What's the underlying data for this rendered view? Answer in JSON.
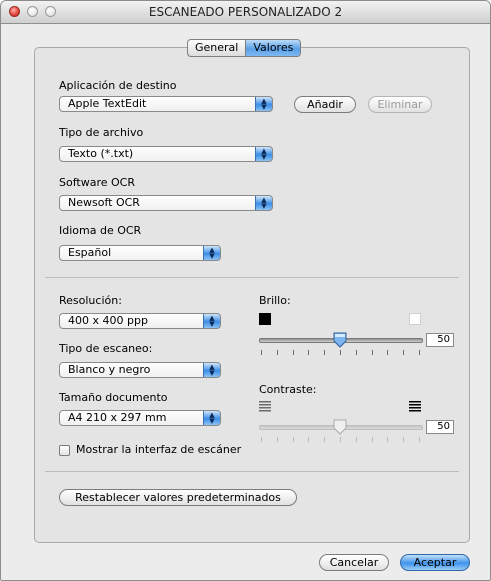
{
  "window": {
    "title": "ESCANEADO PERSONALIZADO 2"
  },
  "tabs": [
    {
      "label": "General",
      "selected": false
    },
    {
      "label": "Valores",
      "selected": true
    }
  ],
  "destination": {
    "label": "Aplicación de destino",
    "value": "Apple TextEdit",
    "add_label": "Añadir",
    "remove_label": "Eliminar"
  },
  "file_type": {
    "label": "Tipo de archivo",
    "value": "Texto (*.txt)"
  },
  "ocr_software": {
    "label": "Software OCR",
    "value": "Newsoft OCR"
  },
  "ocr_language": {
    "label": "Idioma de OCR",
    "value": "Español"
  },
  "resolution": {
    "label": "Resolución:",
    "value": "400 x 400 ppp"
  },
  "scan_type": {
    "label": "Tipo de escaneo:",
    "value": "Blanco y negro"
  },
  "doc_size": {
    "label": "Tamaño documento",
    "value": "A4  210 x 297 mm"
  },
  "show_interface": {
    "label": "Mostrar la interfaz de escáner",
    "checked": false
  },
  "brightness": {
    "label": "Brillo:",
    "value": "50",
    "level": 0.5,
    "enabled": true
  },
  "contrast": {
    "label": "Contraste:",
    "value": "50",
    "level": 0.5,
    "enabled": false
  },
  "reset_label": "Restablecer valores predeterminados",
  "footer": {
    "cancel_label": "Cancelar",
    "accept_label": "Aceptar"
  },
  "colors": {
    "accent": "#3f93eb",
    "panel": "#e4e4e4",
    "window": "#ececec"
  }
}
